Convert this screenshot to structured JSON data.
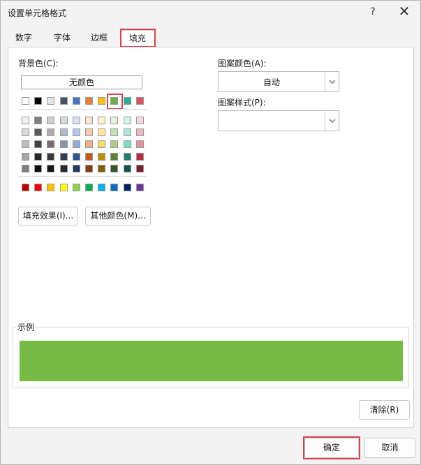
{
  "window": {
    "title": "设置单元格格式",
    "help_label": "?",
    "close_label": "✕"
  },
  "tabs": [
    {
      "label": "数字",
      "active": false
    },
    {
      "label": "字体",
      "active": false
    },
    {
      "label": "边框",
      "active": false
    },
    {
      "label": "填充",
      "active": true
    }
  ],
  "background_color": {
    "label": "背景色(C):",
    "no_color_label": "无颜色",
    "theme_row": [
      "#ffffff",
      "#000000",
      "#e7e6e6",
      "#44546a",
      "#4472c4",
      "#ed7d31",
      "#ffc000",
      "#70ad47",
      "#2aae96",
      "#e04f5f"
    ],
    "selected_color": "#70ad47",
    "tint_rows": [
      [
        "#f2f2f2",
        "#7f7f7f",
        "#d0cece",
        "#d6dce4",
        "#d9e2f3",
        "#fbe4d5",
        "#fff2cc",
        "#e2efd9",
        "#d4f3ee",
        "#f8dadd"
      ],
      [
        "#d9d9d9",
        "#595959",
        "#aeabab",
        "#adb9ca",
        "#b4c6e7",
        "#f7caac",
        "#ffe599",
        "#c5e0b3",
        "#a9e7dc",
        "#f1b5bc"
      ],
      [
        "#bfbfbf",
        "#404040",
        "#757070",
        "#8496b0",
        "#8eaadb",
        "#f4b083",
        "#ffd966",
        "#a8d08d",
        "#7edbcb",
        "#ea909b"
      ],
      [
        "#a6a6a6",
        "#262626",
        "#3a3838",
        "#333f50",
        "#2f5496",
        "#c45911",
        "#bf8f00",
        "#538135",
        "#1f8270",
        "#bd2a3c"
      ],
      [
        "#808080",
        "#0d0d0d",
        "#171616",
        "#222a35",
        "#1f3864",
        "#833c0b",
        "#7f6000",
        "#375623",
        "#14574a",
        "#7e1c28"
      ]
    ],
    "standard_row": [
      "#c00000",
      "#ff0000",
      "#ffc000",
      "#ffff00",
      "#92d050",
      "#00b050",
      "#00b0f0",
      "#0070c0",
      "#002060",
      "#7030a0"
    ]
  },
  "buttons": {
    "fill_effects": "填充效果(I)...",
    "more_colors": "其他颜色(M)...",
    "clear": "清除(R)",
    "ok": "确定",
    "cancel": "取消"
  },
  "pattern": {
    "color_label": "图案颜色(A):",
    "color_value": "自动",
    "style_label": "图案样式(P):",
    "style_value": ""
  },
  "sample": {
    "label": "示例",
    "color": "#76bb43"
  },
  "accent_color": "#d9434f"
}
